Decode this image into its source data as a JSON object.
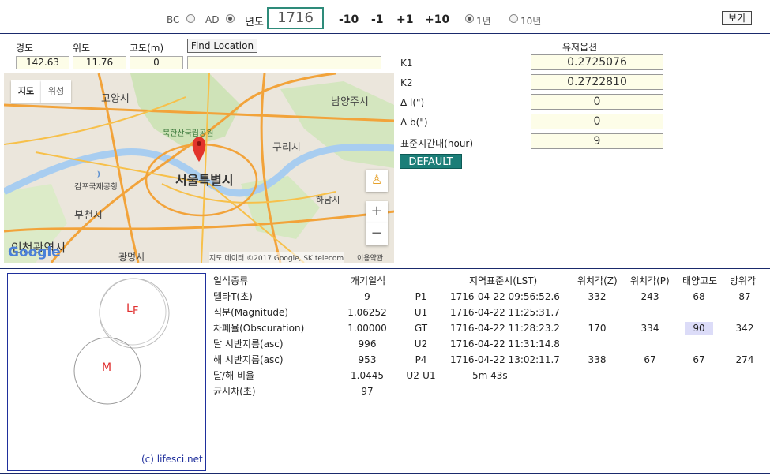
{
  "top": {
    "bc_label": "BC",
    "ad_label": "AD",
    "year_label": "년도",
    "year_value": "1716",
    "steps": [
      "-10",
      "-1",
      "+1",
      "+10"
    ],
    "period_1": "1년",
    "period_10": "10년",
    "view_label": "보기"
  },
  "location": {
    "lon_label": "경도",
    "lat_label": "위도",
    "alt_label": "고도(m)",
    "find_label": "Find Location",
    "lon_value": "142.63",
    "lat_value": "11.76",
    "alt_value": "0",
    "address_value": ""
  },
  "map": {
    "tab_map": "지도",
    "tab_sat": "위성",
    "places": [
      "고양시",
      "남양주시",
      "북한산국립공원",
      "구리시",
      "서울특별시",
      "김포국제공항",
      "하남시",
      "부천시",
      "인천광역시",
      "광명시"
    ],
    "attribution": "지도 데이터 ©2017 Google, SK telecom",
    "terms": "이용약관",
    "logo": "Google",
    "zoom_in": "+",
    "zoom_out": "−"
  },
  "options": {
    "title": "유저옵션",
    "k1_label": "K1",
    "k1_value": "0.2725076",
    "k2_label": "K2",
    "k2_value": "0.2722810",
    "dl_label": "Δ l(\")",
    "dl_value": "0",
    "db_label": "Δ b(\")",
    "db_value": "0",
    "tz_label": "표준시간대(hour)",
    "tz_value": "9",
    "default_label": "DEFAULT"
  },
  "eclipse": {
    "sun_label_l": "L",
    "sun_label_f": "F",
    "moon_label": "M",
    "credit": "(c) lifesci.net"
  },
  "table": {
    "headers": [
      "일식종류",
      "개기일식",
      "지역표준시(LST)",
      "위치각(Z)",
      "위치각(P)",
      "태양고도",
      "방위각"
    ],
    "rows": [
      {
        "name": "델타T(초)",
        "value": "9",
        "code": "P1",
        "time": "1716-04-22 09:56:52.6",
        "z": "332",
        "p": "243",
        "alt": "68",
        "az": "87"
      },
      {
        "name": "식분(Magnitude)",
        "value": "1.06252",
        "code": "U1",
        "time": "1716-04-22 11:25:31.7",
        "z": "",
        "p": "",
        "alt": "",
        "az": ""
      },
      {
        "name": "차폐율(Obscuration)",
        "value": "1.00000",
        "code": "GT",
        "time": "1716-04-22 11:28:23.2",
        "z": "170",
        "p": "334",
        "alt": "90",
        "az": "342"
      },
      {
        "name": "달 시반지름(asc)",
        "value": "996",
        "code": "U2",
        "time": "1716-04-22 11:31:14.8",
        "z": "",
        "p": "",
        "alt": "",
        "az": ""
      },
      {
        "name": "해 시반지름(asc)",
        "value": "953",
        "code": "P4",
        "time": "1716-04-22 13:02:11.7",
        "z": "338",
        "p": "67",
        "alt": "67",
        "az": "274"
      },
      {
        "name": "달/해 비율",
        "value": "1.0445",
        "code": "U2-U1",
        "time": "5m 43s",
        "z": "",
        "p": "",
        "alt": "",
        "az": ""
      },
      {
        "name": "균시차(초)",
        "value": "97",
        "code": "",
        "time": "",
        "z": "",
        "p": "",
        "alt": "",
        "az": ""
      }
    ]
  },
  "colors": {
    "accent": "#2e8b7a",
    "default_btn": "#1b7e78",
    "rule": "#1a2a6c",
    "highlight": "#dcdcf8",
    "eclipse_label": "#e03030"
  }
}
